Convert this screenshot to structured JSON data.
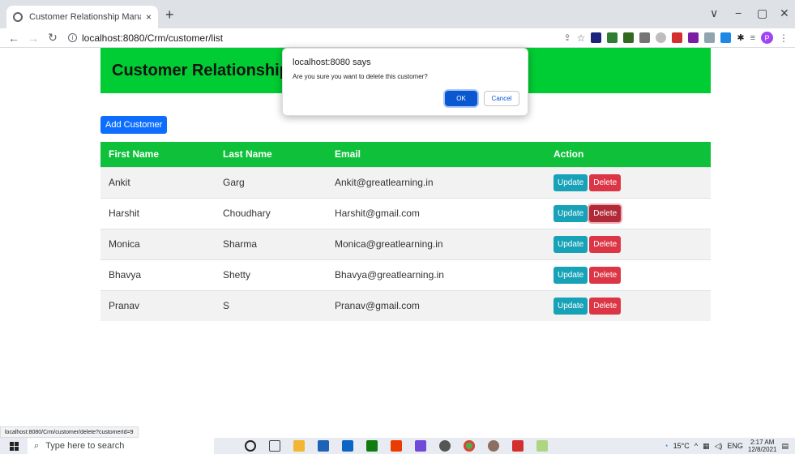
{
  "browser": {
    "tab_title": "Customer Relationship Managemen",
    "tab_close": "×",
    "new_tab": "+",
    "url": "localhost:8080/Crm/customer/list",
    "status_url": "localhost:8080/Crm/customer/delete?customerId=9",
    "window_controls": [
      "∨",
      "−",
      "▢",
      "✕"
    ],
    "profile_initial": "P"
  },
  "page": {
    "header_title": "Customer Relationship Management",
    "add_button": "Add Customer",
    "columns": [
      "First Name",
      "Last Name",
      "Email",
      "Action"
    ],
    "rows": [
      {
        "first": "Ankit",
        "last": "Garg",
        "email": "Ankit@greatlearning.in"
      },
      {
        "first": "Harshit",
        "last": "Choudhary",
        "email": "Harshit@gmail.com"
      },
      {
        "first": "Monica",
        "last": "Sharma",
        "email": "Monica@greatlearning.in"
      },
      {
        "first": "Bhavya",
        "last": "Shetty",
        "email": "Bhavya@greatlearning.in"
      },
      {
        "first": "Pranav",
        "last": "S",
        "email": "Pranav@gmail.com"
      }
    ],
    "update_label": "Update",
    "delete_label": "Delete"
  },
  "dialog": {
    "title": "localhost:8080 says",
    "message": "Are you sure you want to delete this customer?",
    "ok": "OK",
    "cancel": "Cancel"
  },
  "taskbar": {
    "search_placeholder": "Type here to search",
    "temperature": "15°C",
    "language": "ENG",
    "time": "2:17 AM",
    "date": "12/8/2021"
  },
  "colors": {
    "header_green": "#00cc33",
    "table_head_green": "#0fc13a",
    "primary_blue": "#0d6efd",
    "info_teal": "#17a2b8",
    "danger_red": "#dc3545"
  }
}
